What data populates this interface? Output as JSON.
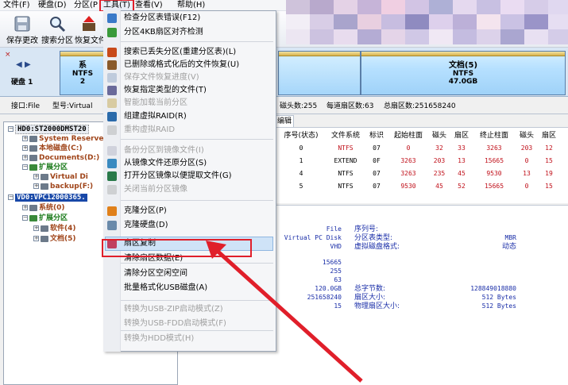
{
  "menubar": {
    "items": [
      "文件(F)",
      "硬盘(D)",
      "分区(P",
      "工具(T)",
      "查看(V)",
      "帮助(H)"
    ]
  },
  "toolbar": {
    "buttons": [
      "保存更改",
      "搜索分区",
      "恢复文件"
    ]
  },
  "diskbar": {
    "left_disk_label": "硬盘 1",
    "partitions": [
      {
        "name": "系",
        "fs": "NTFS",
        "size": "2"
      },
      {
        "name": "文档(5)",
        "fs": "NTFS",
        "size": "47.0GB"
      }
    ]
  },
  "infobar": {
    "interface": "接口:File",
    "model": "型号:Virtual",
    "heads": "磁头数:255",
    "sectors_per_track": "每道扇区数:63",
    "total_sectors": "总扇区数:251658240"
  },
  "tree": {
    "hd0": "HD0:ST2000DMST20",
    "hd0_children": [
      "System Reserve",
      "本地磁盘(C:)",
      "Documents(D:)",
      "扩展分区",
      "Virtual Di",
      "backup(F:)"
    ],
    "vd0": "VD0:VPC12000365.",
    "vd0_children": [
      "系统(0)",
      "扩展分区",
      "软件(4)",
      "文档(5)"
    ]
  },
  "tabs": {
    "edit_tab": "编辑"
  },
  "table": {
    "headers": [
      "序号(状态)",
      "文件系统",
      "标识",
      "起始柱面",
      "磁头",
      "扇区",
      "终止柱面",
      "磁头",
      "扇区"
    ],
    "rows": [
      [
        "0",
        "NTFS",
        "07",
        "0",
        "32",
        "33",
        "3263",
        "203",
        "12"
      ],
      [
        "1",
        "EXTEND",
        "0F",
        "3263",
        "203",
        "13",
        "15665",
        "0",
        "15"
      ],
      [
        "4",
        "NTFS",
        "07",
        "3263",
        "235",
        "45",
        "9530",
        "13",
        "19"
      ],
      [
        "5",
        "NTFS",
        "07",
        "9530",
        "45",
        "52",
        "15665",
        "0",
        "15"
      ]
    ]
  },
  "details": {
    "col1_values": [
      "File",
      "Virtual PC Disk",
      "VHD"
    ],
    "col2_labels": [
      "序列号:",
      "分区表类型:",
      "虚拟磁盘格式:"
    ],
    "col3_values": [
      "MBR",
      "动态"
    ],
    "geo_values": [
      "15665",
      "255",
      "63",
      "120.0GB",
      "251658240",
      "15"
    ],
    "geo_labels": [
      "总字节数:",
      "扇区大小:",
      "物理扇区大小:"
    ],
    "geo_right": [
      "128849018880",
      "512 Bytes",
      "512 Bytes"
    ]
  },
  "dropdown": {
    "items": [
      {
        "label": "检查分区表错误(F12)",
        "enabled": true,
        "icon": "check-icon"
      },
      {
        "label": "分区4KB扇区对齐检测",
        "enabled": true,
        "icon": "align-icon"
      },
      {
        "label": "搜索已丢失分区(重建分区表)(L)",
        "enabled": true,
        "icon": "search-icon"
      },
      {
        "label": "已删除或格式化后的文件恢复(U)",
        "enabled": true,
        "icon": "recover-icon"
      },
      {
        "label": "保存文件恢复进度(V)",
        "enabled": false,
        "icon": "save-icon"
      },
      {
        "label": "恢复指定类型的文件(T)",
        "enabled": true,
        "icon": "filetype-icon"
      },
      {
        "label": "智能加载当前分区",
        "enabled": false,
        "icon": "smart-icon"
      },
      {
        "label": "组建虚拟RAID(R)",
        "enabled": true,
        "icon": "raid-icon"
      },
      {
        "label": "重构虚拟RAID",
        "enabled": false,
        "icon": "rebuild-icon"
      },
      {
        "label": "备份分区到镜像文件(I)",
        "enabled": false,
        "icon": "backup-icon"
      },
      {
        "label": "从镜像文件还原分区(S)",
        "enabled": true,
        "icon": "restore-icon"
      },
      {
        "label": "打开分区镜像以便提取文件(G)",
        "enabled": true,
        "icon": "open-image-icon"
      },
      {
        "label": "关闭当前分区镜像",
        "enabled": false,
        "icon": "close-image-icon"
      },
      {
        "label": "克隆分区(P)",
        "enabled": true,
        "icon": "clone-partition-icon"
      },
      {
        "label": "克隆硬盘(D)",
        "enabled": true,
        "icon": "clone-disk-icon"
      },
      {
        "label": "扇区复制",
        "enabled": true,
        "icon": "sector-copy-icon"
      },
      {
        "label": "清除扇区数据(E)",
        "enabled": true,
        "icon": ""
      },
      {
        "label": "清除分区空闲空间",
        "enabled": true,
        "icon": ""
      },
      {
        "label": "批量格式化USB磁盘(A)",
        "enabled": true,
        "icon": ""
      },
      {
        "label": "转换为USB-ZIP启动模式(Z)",
        "enabled": false,
        "icon": ""
      },
      {
        "label": "转换为USB-FDD启动模式(F)",
        "enabled": false,
        "icon": ""
      },
      {
        "label": "转换为HDD模式(H)",
        "enabled": false,
        "icon": ""
      }
    ]
  },
  "colors": {
    "highlight": "#e01f2a",
    "selection": "#1848a8",
    "partition_fill": "#b6e0ff",
    "value_blue": "#1a2ea8"
  }
}
